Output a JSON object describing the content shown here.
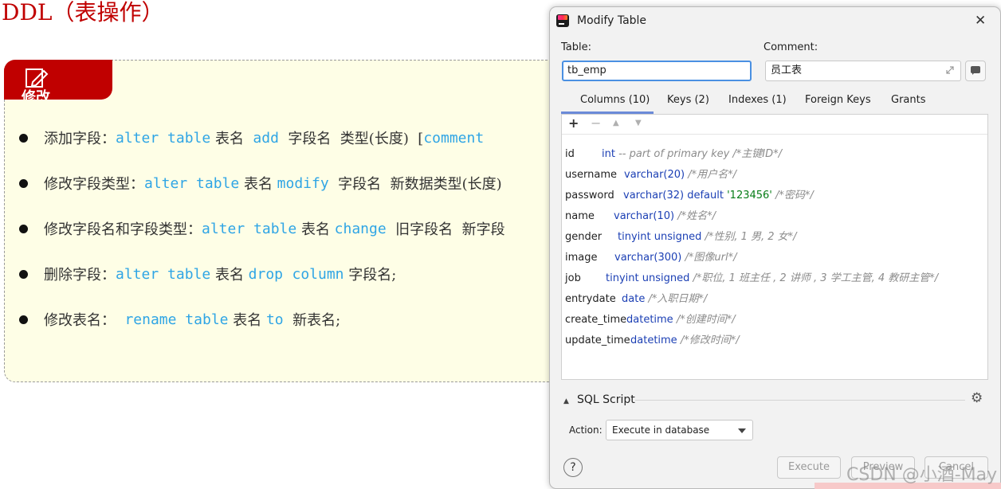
{
  "slide": {
    "title": "DDL（表操作）",
    "badge_label": "修改",
    "bullets": [
      {
        "parts": [
          {
            "text": "添加字段：",
            "kind": "cn"
          },
          {
            "text": "alter table",
            "kind": "kw"
          },
          {
            "text": " 表名  ",
            "kind": "cn"
          },
          {
            "text": "add",
            "kind": "kw"
          },
          {
            "text": "  字段名  类型(长度)  [",
            "kind": "cn"
          },
          {
            "text": "comment",
            "kind": "kw"
          }
        ]
      },
      {
        "parts": [
          {
            "text": "修改字段类型：",
            "kind": "cn"
          },
          {
            "text": "alter table",
            "kind": "kw"
          },
          {
            "text": " 表名 ",
            "kind": "cn"
          },
          {
            "text": "modify",
            "kind": "kw"
          },
          {
            "text": "  字段名  新数据类型(长度)",
            "kind": "cn"
          }
        ]
      },
      {
        "parts": [
          {
            "text": "修改字段名和字段类型：",
            "kind": "cn"
          },
          {
            "text": "alter table",
            "kind": "kw"
          },
          {
            "text": " 表名 ",
            "kind": "cn"
          },
          {
            "text": "change",
            "kind": "kw"
          },
          {
            "text": "  旧字段名  新字段",
            "kind": "cn"
          }
        ]
      },
      {
        "parts": [
          {
            "text": "删除字段：",
            "kind": "cn"
          },
          {
            "text": "alter table",
            "kind": "kw"
          },
          {
            "text": " 表名 ",
            "kind": "cn"
          },
          {
            "text": "drop",
            "kind": "kw"
          },
          {
            "text": "  ",
            "kind": "cn"
          },
          {
            "text": "column",
            "kind": "kw"
          },
          {
            "text": " 字段名;",
            "kind": "cn"
          }
        ]
      },
      {
        "parts": [
          {
            "text": "修改表名：  ",
            "kind": "cn"
          },
          {
            "text": "rename table",
            "kind": "kw"
          },
          {
            "text": " 表名 ",
            "kind": "cn"
          },
          {
            "text": "to",
            "kind": "kw"
          },
          {
            "text": "  新表名;",
            "kind": "cn"
          }
        ]
      }
    ]
  },
  "dialog": {
    "title": "Modify Table",
    "close_icon": "close-icon",
    "table_label": "Table:",
    "table_value": "tb_emp",
    "comment_label": "Comment:",
    "comment_value": "员工表",
    "tabs": [
      "Columns (10)",
      "Keys (2)",
      "Indexes (1)",
      "Foreign Keys",
      "Grants"
    ],
    "active_tab": "Columns (10)",
    "toolbar": {
      "add": "+",
      "remove": "−",
      "up": "▲",
      "down": "▼"
    },
    "columns": [
      {
        "name": "id",
        "type": "int",
        "extra": "",
        "comment": "-- part of primary key /*主键ID*/"
      },
      {
        "name": "username",
        "type": "varchar(20)",
        "extra": "",
        "comment": "/*用户名*/"
      },
      {
        "name": "password",
        "type": "varchar(32) default ",
        "extra": "'123456'",
        "comment": "/*密码*/"
      },
      {
        "name": "name",
        "type": "varchar(10)",
        "extra": "",
        "comment": "/*姓名*/"
      },
      {
        "name": "gender",
        "type": "tinyint unsigned",
        "extra": "",
        "comment": "/*性别, 1 男, 2 女*/"
      },
      {
        "name": "image",
        "type": "varchar(300)",
        "extra": "",
        "comment": "/*图像url*/"
      },
      {
        "name": "job",
        "type": "tinyint unsigned",
        "extra": "",
        "comment": "/*职位, 1 班主任 , 2 讲师 , 3 学工主管, 4 教研主管*/"
      },
      {
        "name": "entrydate",
        "type": "date",
        "extra": "",
        "comment": "/*入职日期*/"
      },
      {
        "name": "create_time",
        "type": "datetime",
        "extra": "",
        "comment": "/*创建时间*/"
      },
      {
        "name": "update_time",
        "type": "datetime",
        "extra": "",
        "comment": "/*修改时间*/"
      }
    ],
    "sql_section": "SQL Script",
    "action_label": "Action:",
    "action_value": "Execute in database",
    "help": "?",
    "buttons": {
      "execute": "Execute",
      "preview": "Preview",
      "cancel": "Cancel"
    }
  },
  "watermark": "CSDN @小酒-May",
  "colors": {
    "accent_red": "#c00000",
    "keyword_blue": "#2fa5e5",
    "type_blue": "#1b3fb4",
    "string_green": "#077d17",
    "focus_blue": "#4a90e2"
  }
}
